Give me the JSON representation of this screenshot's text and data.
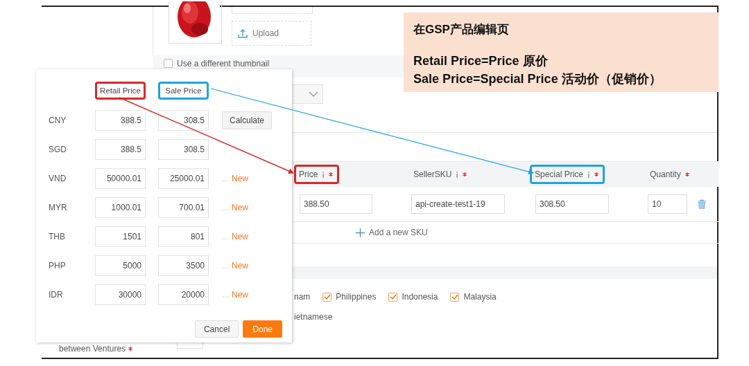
{
  "callout": {
    "lines": [
      "在GSP产品编辑页",
      "Retail Price=Price  原价",
      "Sale Price=Special Price  活动价（促销价）"
    ]
  },
  "product_images": {
    "upload_label": "Upload"
  },
  "thumbnail_option": {
    "label": "Use a different thumbnail",
    "checked": false
  },
  "sku_table": {
    "columns": [
      {
        "label": "Price",
        "info": true,
        "required": true,
        "color": "#d42a2a"
      },
      {
        "label": "SellerSKU",
        "info": true,
        "required": true
      },
      {
        "label": "Special Price",
        "info": true,
        "required": true,
        "color": "#1ea3dc"
      },
      {
        "label": "Quantity",
        "info": false,
        "required": true
      }
    ],
    "rows": [
      {
        "price": "388.50",
        "seller_sku": "api-create-test1-19",
        "special_price": "308.50",
        "quantity": "10"
      }
    ],
    "add_label": "Add a new SKU"
  },
  "ventures": {
    "partial_label": "nam",
    "items": [
      {
        "label": "Philippines",
        "checked": true
      },
      {
        "label": "Indonesia",
        "checked": true
      },
      {
        "label": "Malaysia",
        "checked": true
      }
    ]
  },
  "languages_text": "ietnamese",
  "ventures_field": {
    "label": "between Ventures",
    "required": true
  },
  "price_popup": {
    "columns": [
      {
        "label": "Retail Price",
        "color": "#d42a2a"
      },
      {
        "label": "Sale Price",
        "color": "#1ea3dc"
      }
    ],
    "rows": [
      {
        "currency": "CNY",
        "retail": "388.5",
        "sale": "308.5",
        "action": {
          "kind": "button",
          "label": "Calculate"
        }
      },
      {
        "currency": "SGD",
        "retail": "388.5",
        "sale": "308.5"
      },
      {
        "currency": "VND",
        "retail": "50000.01",
        "sale": "25000.01",
        "action": {
          "kind": "link",
          "prefix": "...",
          "label": "New"
        }
      },
      {
        "currency": "MYR",
        "retail": "1000.01",
        "sale": "700.01",
        "action": {
          "kind": "link",
          "prefix": "...",
          "label": "New"
        }
      },
      {
        "currency": "THB",
        "retail": "1501",
        "sale": "801",
        "action": {
          "kind": "link",
          "prefix": "...",
          "label": "New"
        }
      },
      {
        "currency": "PHP",
        "retail": "5000",
        "sale": "3500",
        "action": {
          "kind": "link",
          "prefix": "...",
          "label": "New"
        }
      },
      {
        "currency": "IDR",
        "retail": "30000",
        "sale": "20000",
        "action": {
          "kind": "link",
          "prefix": "...",
          "label": "New"
        }
      }
    ],
    "buttons": [
      {
        "label": "Cancel",
        "kind": "secondary"
      },
      {
        "label": "Done",
        "kind": "primary"
      }
    ]
  }
}
